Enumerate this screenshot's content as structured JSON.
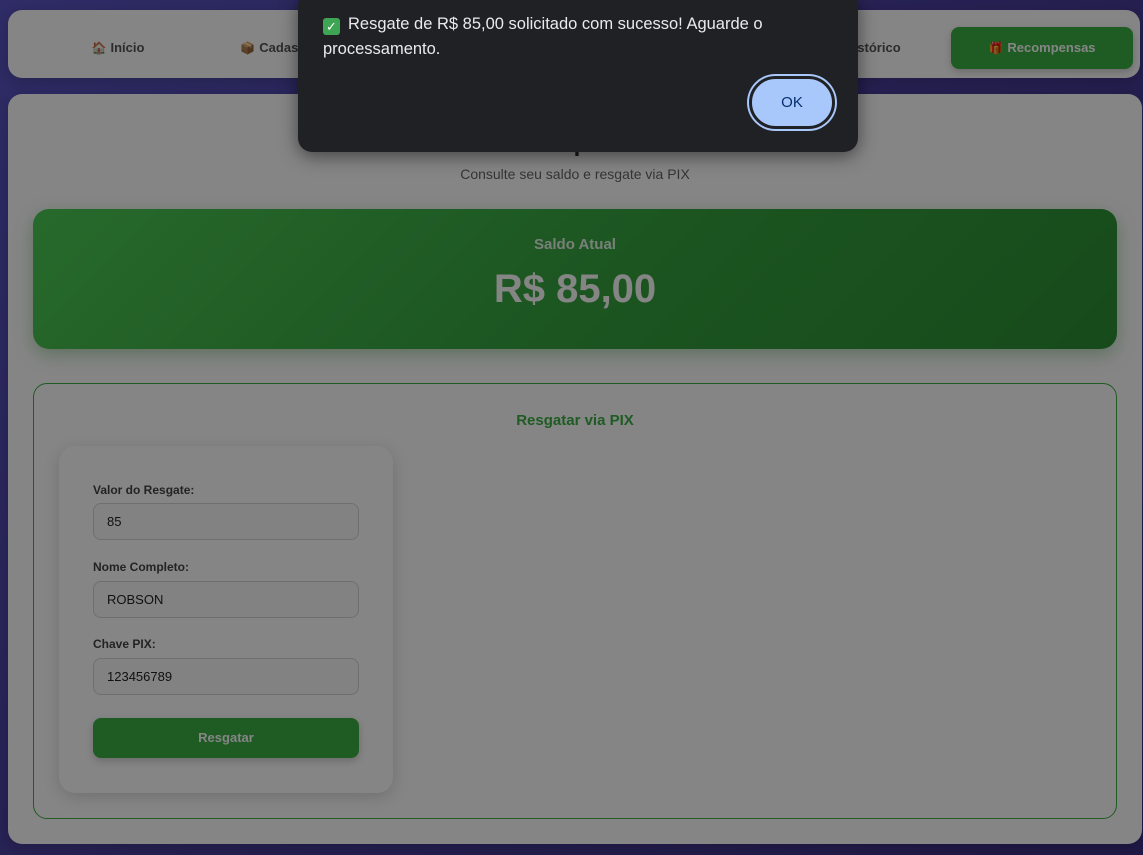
{
  "nav": {
    "items": [
      {
        "icon": "🏠",
        "label": "Início"
      },
      {
        "icon": "📦",
        "label": "Cadastro"
      },
      {
        "icon": "📋",
        "label": "Histórico"
      },
      {
        "icon": "🎁",
        "label": "Recompensas"
      }
    ]
  },
  "main": {
    "title": "Recompensas",
    "subtitle": "Consulte seu saldo e resgate via PIX",
    "balance": {
      "label": "Saldo Atual",
      "value": "R$ 85,00"
    }
  },
  "pix": {
    "title": "Resgatar via PIX",
    "fields": [
      {
        "label": "Valor do Resgate:",
        "value": "85"
      },
      {
        "label": "Nome Completo:",
        "value": "ROBSON"
      },
      {
        "label": "Chave PIX:",
        "value": "123456789"
      }
    ],
    "submit_label": "Resgatar"
  },
  "dialog": {
    "message": "Resgate de R$ 85,00 solicitado com sucesso! Aguarde o processamento.",
    "ok_label": "OK",
    "check_glyph": "✓"
  },
  "colors": {
    "accent": "#3bb143",
    "dialog_bg": "#202124",
    "ok_button": "#a8c7fa"
  }
}
